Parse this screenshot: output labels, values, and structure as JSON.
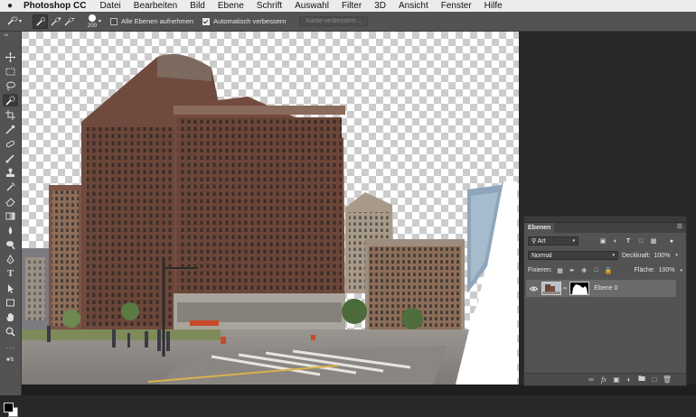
{
  "menubar": {
    "app_name": "Photoshop CC",
    "items": [
      "Datei",
      "Bearbeiten",
      "Bild",
      "Ebene",
      "Schrift",
      "Auswahl",
      "Filter",
      "3D",
      "Ansicht",
      "Fenster",
      "Hilfe"
    ]
  },
  "options_bar": {
    "brush_size": "200",
    "sample_all_layers_label": "Alle Ebenen aufnehmen",
    "sample_all_layers_checked": false,
    "auto_enhance_label": "Automatisch verbessern",
    "auto_enhance_checked": true,
    "refine_edge_label": "Kante verbessern..."
  },
  "toolbar": {
    "tools": [
      "move-tool-icon",
      "marquee-tool-icon",
      "lasso-tool-icon",
      "quick-selection-tool-icon",
      "crop-tool-icon",
      "eyedropper-tool-icon",
      "healing-brush-tool-icon",
      "brush-tool-icon",
      "clone-stamp-tool-icon",
      "history-brush-tool-icon",
      "eraser-tool-icon",
      "gradient-tool-icon",
      "blur-tool-icon",
      "dodge-tool-icon",
      "pen-tool-icon",
      "type-tool-icon",
      "path-selection-tool-icon",
      "rectangle-tool-icon",
      "hand-tool-icon",
      "zoom-tool-icon",
      "more-tools-icon"
    ],
    "active_tool": "quick-selection-tool-icon",
    "foreground_color": "#000000",
    "background_color": "#ffffff"
  },
  "layers_panel": {
    "tab_label": "Ebenen",
    "filter_kind": "Art",
    "blend_mode": "Normal",
    "opacity_label": "Deckkraft:",
    "opacity_value": "100%",
    "lock_label": "Fixieren:",
    "fill_label": "Fläche:",
    "fill_value": "100%",
    "layers": [
      {
        "name": "Ebene 0",
        "visible": true,
        "selected": true,
        "has_mask": true
      }
    ]
  }
}
